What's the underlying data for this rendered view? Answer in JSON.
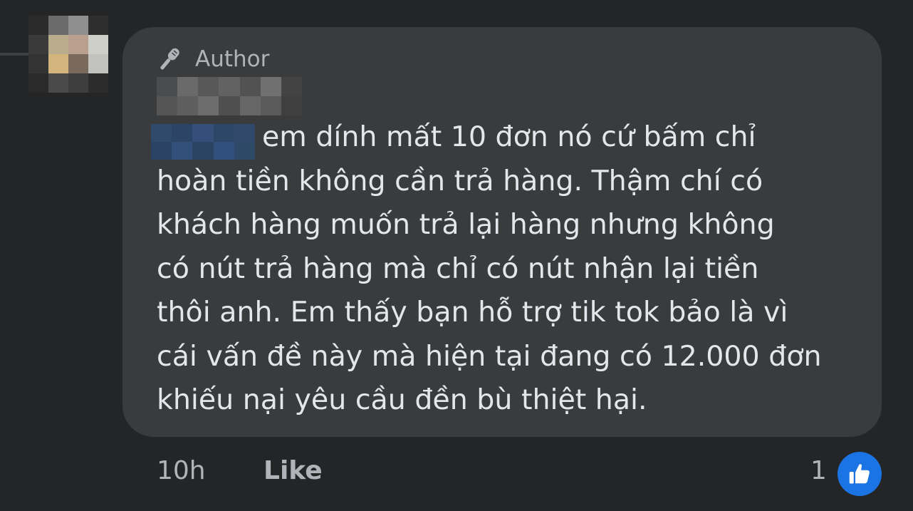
{
  "comment": {
    "author_badge_label": "Author",
    "author_badge_icon": "microphone-icon",
    "author_name": "",
    "mention": "",
    "body_lines": [
      "em dính mất 10 đơn nó cứ bấm chỉ",
      "hoàn tiền không cần trả hàng. Thậm chí có",
      "khách hàng muốn trả lại hàng nhưng không",
      "có nút trả hàng mà chỉ có nút nhận lại tiền",
      "thôi anh. Em thấy bạn hỗ trợ tik tok bảo là vì",
      "cái vấn đề này mà hiện tại đang có 12.000 đơn",
      "khiếu nại yêu cầu đền bù thiệt hại."
    ]
  },
  "meta": {
    "timestamp": "10h",
    "like_label": "Like",
    "reaction_count": "1",
    "reaction_icon": "thumbs-up-icon"
  },
  "colors": {
    "background": "#242526",
    "bubble": "#3a3b3c",
    "text_primary": "#e4e6eb",
    "text_secondary": "#b0b3b8",
    "like_blue": "#1b74e4"
  }
}
